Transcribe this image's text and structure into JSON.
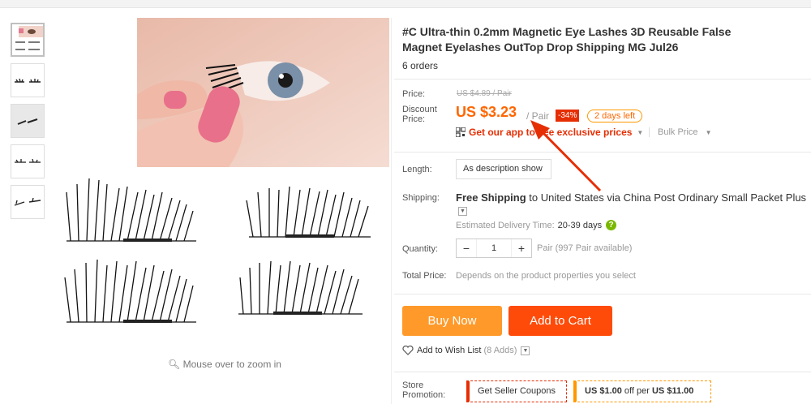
{
  "thumbnails": [
    {
      "name": "thumbnail-1",
      "active": true
    },
    {
      "name": "thumbnail-2",
      "active": false
    },
    {
      "name": "thumbnail-3",
      "active": false
    },
    {
      "name": "thumbnail-4",
      "active": false
    },
    {
      "name": "thumbnail-5",
      "active": false
    }
  ],
  "zoom_hint": "Mouse over to zoom in",
  "product": {
    "title": "#C Ultra-thin 0.2mm Magnetic Eye Lashes 3D Reusable False Magnet Eyelashes OutTop Drop Shipping MG Jul26",
    "orders": "6 orders"
  },
  "price": {
    "label": "Price:",
    "original": "US $4.89 / Pair",
    "discount_label": "Discount Price:",
    "current": "US $3.23",
    "unit": "/ Pair",
    "percent_off": "-34%",
    "days_left": "2 days left",
    "app_link": "Get our app to see exclusive prices",
    "bulk": "Bulk Price"
  },
  "length": {
    "label": "Length:",
    "option": "As description show"
  },
  "shipping": {
    "label": "Shipping:",
    "text_bold_1": "Free Shipping",
    "text_mid": " to ",
    "text_bold_2": "United States via China Post Ordinary Small Packet Plus",
    "est_label": "Estimated Delivery Time:",
    "est_value": "20-39 days"
  },
  "quantity": {
    "label": "Quantity:",
    "minus": "−",
    "value": "1",
    "plus": "+",
    "available": "Pair (997 Pair available)"
  },
  "total": {
    "label": "Total Price:",
    "value": "Depends on the product properties you select"
  },
  "actions": {
    "buy_now": "Buy Now",
    "add_to_cart": "Add to Cart",
    "wishlist": "Add to Wish List",
    "wishlist_count": "(8 Adds)"
  },
  "store": {
    "label": "Store Promotion:",
    "coupon": "Get Seller Coupons",
    "deal_amount": "US $1.00",
    "deal_mid": " off per ",
    "deal_threshold": "US $11.00"
  },
  "colors": {
    "price": "#ff6600",
    "buy_now": "#ff9a2a",
    "add_to_cart": "#ff4b0a",
    "badge": "#e62e04",
    "arrow": "#e62e04"
  }
}
